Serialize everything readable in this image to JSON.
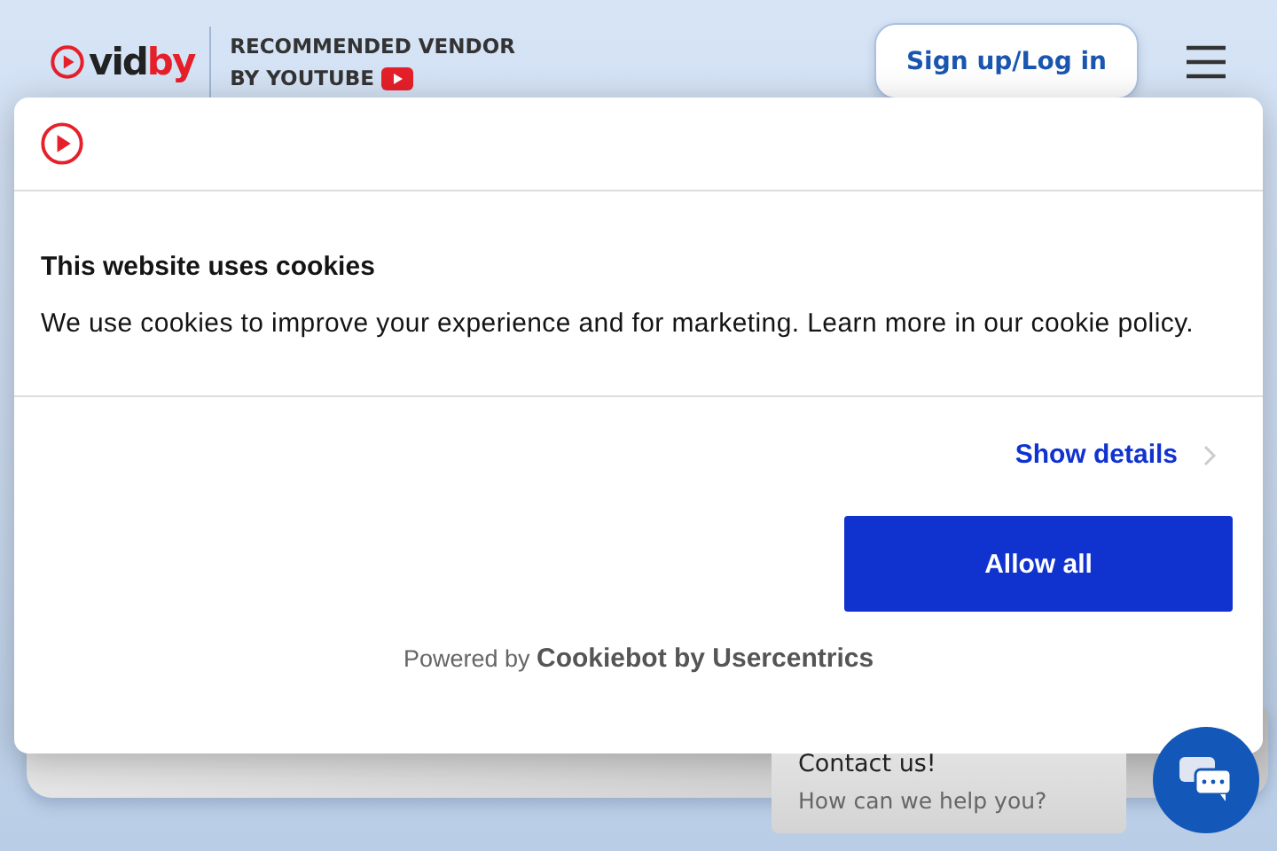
{
  "header": {
    "logo_text": "vid",
    "logo_accent": "by",
    "tagline_line1": "RECOMMENDED  VENDOR",
    "tagline_line2": "BY YOUTUBE",
    "login_button": "Sign up/Log in"
  },
  "cookie_dialog": {
    "title": "This website uses cookies",
    "body": "We use cookies to improve your experience and for marketing. Learn more in our cookie policy.",
    "details_link": "Show details",
    "allow_button": "Allow all",
    "powered_by": "Powered by **Cookiebot by Usercentrics**"
  },
  "chat": {
    "title": "Contact us!",
    "subtitle": "How can we help you?"
  }
}
